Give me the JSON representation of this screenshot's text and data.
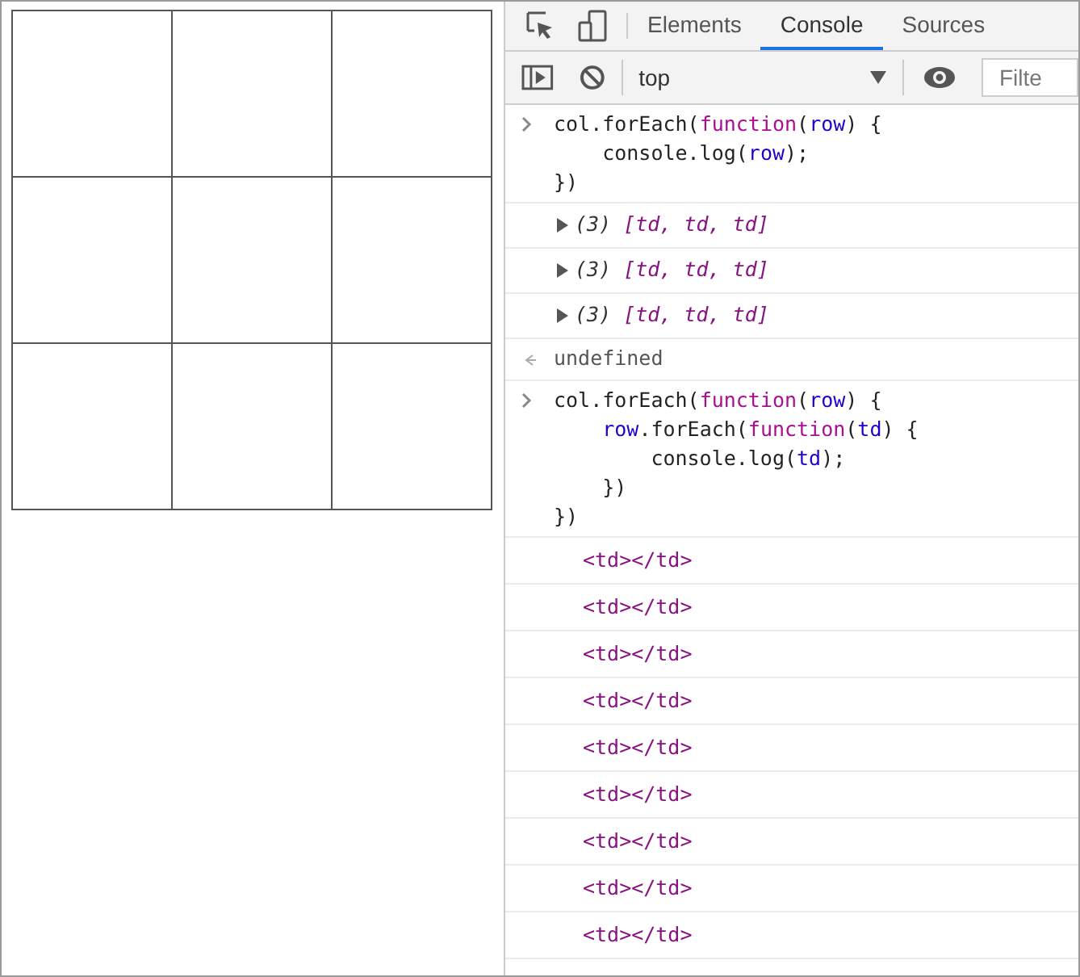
{
  "devtools": {
    "tabs": [
      {
        "label": "Elements",
        "selected": false
      },
      {
        "label": "Console",
        "selected": true
      },
      {
        "label": "Sources",
        "selected": false
      }
    ],
    "context": "top",
    "filter": {
      "placeholder": "Filte"
    }
  },
  "console": [
    {
      "kind": "input",
      "lines": [
        [
          {
            "text": "col.forEach(",
            "kind": "plain"
          },
          {
            "text": "function",
            "kind": "keyword"
          },
          {
            "text": "(",
            "kind": "plain"
          },
          {
            "text": "row",
            "kind": "param"
          },
          {
            "text": ") {",
            "kind": "plain"
          }
        ],
        [
          {
            "text": "    console.log(",
            "kind": "plain"
          },
          {
            "text": "row",
            "kind": "param"
          },
          {
            "text": ");",
            "kind": "plain"
          }
        ],
        [
          {
            "text": "})",
            "kind": "plain"
          }
        ]
      ]
    },
    {
      "kind": "array",
      "count": "(3)",
      "value": "[td, td, td]"
    },
    {
      "kind": "array",
      "count": "(3)",
      "value": "[td, td, td]"
    },
    {
      "kind": "array",
      "count": "(3)",
      "value": "[td, td, td]"
    },
    {
      "kind": "result",
      "value": "undefined"
    },
    {
      "kind": "input",
      "lines": [
        [
          {
            "text": "col.forEach(",
            "kind": "plain"
          },
          {
            "text": "function",
            "kind": "keyword"
          },
          {
            "text": "(",
            "kind": "plain"
          },
          {
            "text": "row",
            "kind": "param"
          },
          {
            "text": ") {",
            "kind": "plain"
          }
        ],
        [
          {
            "text": "    row",
            "kind": "param"
          },
          {
            "text": ".forEach(",
            "kind": "plain"
          },
          {
            "text": "function",
            "kind": "keyword"
          },
          {
            "text": "(",
            "kind": "plain"
          },
          {
            "text": "td",
            "kind": "param"
          },
          {
            "text": ") {",
            "kind": "plain"
          }
        ],
        [
          {
            "text": "        console.log(",
            "kind": "plain"
          },
          {
            "text": "td",
            "kind": "param"
          },
          {
            "text": ");",
            "kind": "plain"
          }
        ],
        [
          {
            "text": "    })",
            "kind": "plain"
          }
        ],
        [
          {
            "text": "})",
            "kind": "plain"
          }
        ]
      ]
    },
    {
      "kind": "element",
      "value": "<td></td>"
    },
    {
      "kind": "element",
      "value": "<td></td>"
    },
    {
      "kind": "element",
      "value": "<td></td>"
    },
    {
      "kind": "element",
      "value": "<td></td>"
    },
    {
      "kind": "element",
      "value": "<td></td>"
    },
    {
      "kind": "element",
      "value": "<td></td>"
    },
    {
      "kind": "element",
      "value": "<td></td>"
    },
    {
      "kind": "element",
      "value": "<td></td>"
    },
    {
      "kind": "element",
      "value": "<td></td>"
    }
  ]
}
